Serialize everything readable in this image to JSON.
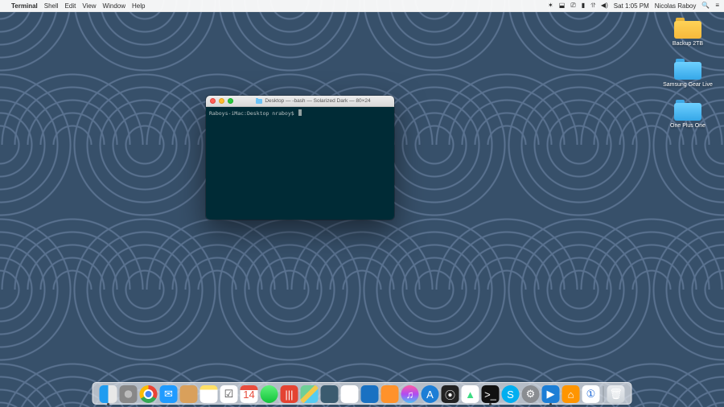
{
  "menubar": {
    "app_name": "Terminal",
    "menus": [
      "Shell",
      "Edit",
      "View",
      "Window",
      "Help"
    ],
    "status": {
      "time": "Sat 1:05 PM",
      "user": "Nicolas Raboy"
    }
  },
  "desktop_icons": [
    {
      "label": "Backup 2TB",
      "color": "yellow"
    },
    {
      "label": "Samsung Gear Live",
      "color": "blue"
    },
    {
      "label": "One Plus One",
      "color": "blue"
    }
  ],
  "terminal": {
    "title": "Desktop — -bash — Solarized Dark — 80×24",
    "prompt": "Raboys-iMac:Desktop nraboy$ "
  },
  "dock": {
    "items": [
      {
        "name": "Finder",
        "cls": "finder",
        "glyph": "",
        "running": true
      },
      {
        "name": "Launchpad",
        "cls": "launchpad",
        "glyph": "",
        "running": false
      },
      {
        "name": "Google Chrome",
        "cls": "chrome",
        "glyph": "",
        "running": false
      },
      {
        "name": "Mail",
        "cls": "mail",
        "glyph": "✉",
        "running": false
      },
      {
        "name": "Contacts",
        "cls": "contacts",
        "glyph": "",
        "running": false
      },
      {
        "name": "Notes",
        "cls": "notes",
        "glyph": "",
        "running": false
      },
      {
        "name": "Reminders",
        "cls": "reminders",
        "glyph": "☑",
        "running": false
      },
      {
        "name": "Calendar",
        "cls": "calendar",
        "glyph": "14",
        "running": false
      },
      {
        "name": "Messages",
        "cls": "messages",
        "glyph": "",
        "running": false
      },
      {
        "name": "Todoist",
        "cls": "todoist",
        "glyph": "|||",
        "running": false
      },
      {
        "name": "Maps",
        "cls": "maps",
        "glyph": "",
        "running": false
      },
      {
        "name": "Preview",
        "cls": "preview",
        "glyph": "",
        "running": false
      },
      {
        "name": "Numbers",
        "cls": "numbers",
        "glyph": "▮▮",
        "running": false
      },
      {
        "name": "Keynote",
        "cls": "keynote",
        "glyph": "",
        "running": false
      },
      {
        "name": "Pages",
        "cls": "pages",
        "glyph": "",
        "running": false
      },
      {
        "name": "iTunes",
        "cls": "itunes round",
        "glyph": "♫",
        "running": false
      },
      {
        "name": "App Store",
        "cls": "appstore round",
        "glyph": "A",
        "running": false
      },
      {
        "name": "Unity",
        "cls": "unity",
        "glyph": "⦿",
        "running": false
      },
      {
        "name": "Android Studio",
        "cls": "android",
        "glyph": "▲",
        "running": false
      },
      {
        "name": "Terminal",
        "cls": "termico",
        "glyph": ">_",
        "running": true
      },
      {
        "name": "Skype",
        "cls": "skype round",
        "glyph": "S",
        "running": false
      },
      {
        "name": "System Preferences",
        "cls": "sysp round",
        "glyph": "⚙",
        "running": false
      },
      {
        "name": "ScreenFlow",
        "cls": "screenflow",
        "glyph": "▶",
        "running": true
      },
      {
        "name": "Sublime Text",
        "cls": "sublime",
        "glyph": "⌂",
        "running": false
      },
      {
        "name": "1Password",
        "cls": "onepw",
        "glyph": "①",
        "running": false
      }
    ],
    "trash": {
      "name": "Trash",
      "cls": "trash",
      "glyph": "🗑"
    }
  }
}
